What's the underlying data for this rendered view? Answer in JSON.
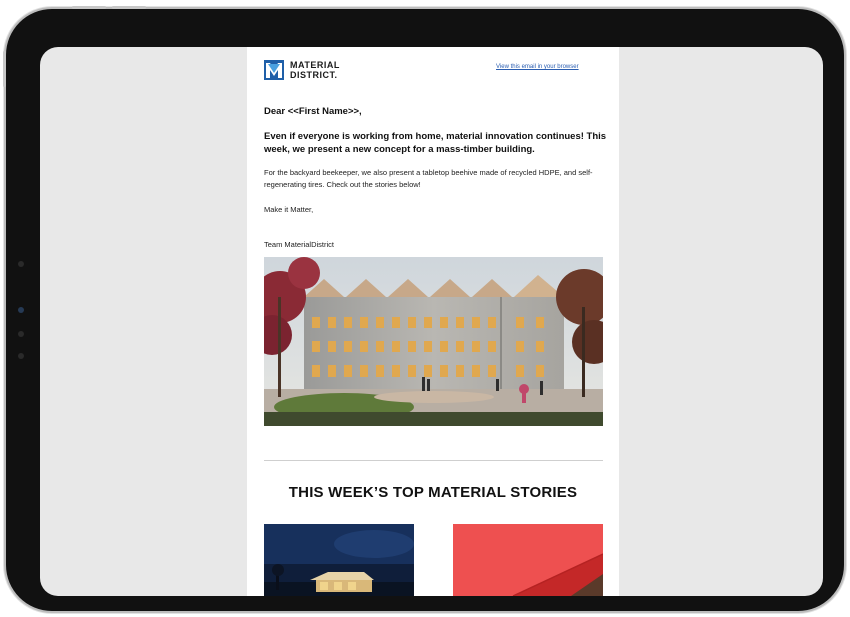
{
  "email": {
    "logo_line1": "MATERIAL",
    "logo_line2": "DISTRICT.",
    "view_in_browser": "View this email in your browser",
    "greeting": "Dear <<First Name>>,",
    "headline": "Even if everyone is working from home, material innovation continues! This week, we present a new concept for a mass-timber building.",
    "body": "For the backyard beekeeper, we also present a tabletop beehive made of recycled HDPE, and self-regenerating tires. Check out the stories below!",
    "signoff": "Make it Matter,",
    "team": "Team MaterialDistrict",
    "section_title": "THIS WEEK’S TOP MATERIAL STORIES"
  },
  "colors": {
    "brand_blue": "#1f5fa8",
    "link_blue": "#2a5db0",
    "device_frame": "#111111"
  }
}
